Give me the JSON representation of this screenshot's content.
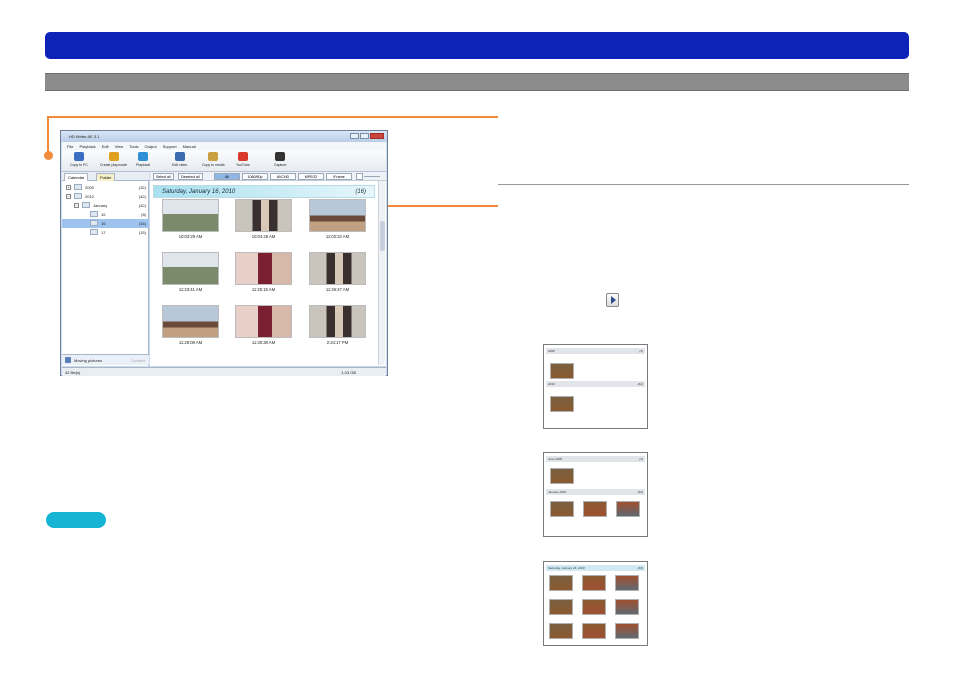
{
  "app": {
    "window_title": "HD Writer AE 3.1",
    "menu": [
      "File",
      "Playback",
      "Edit",
      "View",
      "Tools",
      "Output",
      "Support",
      "Manual"
    ],
    "toolbar": [
      "Copy to PC",
      "Create playmovie",
      "Playback",
      "Edit video",
      "Copy to media",
      "YouTube",
      "Capture"
    ],
    "tabs": {
      "calendar": "Calendar",
      "folder": "Folder"
    },
    "tree": [
      {
        "label": "2009",
        "count": "(32)",
        "level": 0,
        "expander": "+"
      },
      {
        "label": "2010",
        "count": "(42)",
        "level": 0,
        "expander": "−"
      },
      {
        "label": "January",
        "count": "(42)",
        "level": 1,
        "expander": "−"
      },
      {
        "label": "15",
        "count": "(8)",
        "level": 2,
        "expander": ""
      },
      {
        "label": "16",
        "count": "(16)",
        "level": 2,
        "expander": "",
        "selected": true
      },
      {
        "label": "17",
        "count": "(15)",
        "level": 2,
        "expander": ""
      }
    ],
    "controls": {
      "select_all": "Select all",
      "deselect_all": "Deselect all",
      "filters": [
        "All",
        "1080/60p",
        "AVCHD",
        "MPEG2",
        "iFrame"
      ]
    },
    "date_header": {
      "title": "Saturday, January 16, 2010",
      "count": "(16)"
    },
    "thumbnails": [
      {
        "time": "10:03:29 AM",
        "scene": "ferris"
      },
      {
        "time": "10:04:28 AM",
        "scene": "couple"
      },
      {
        "time": "11:02:22 AM",
        "scene": "coaster"
      },
      {
        "time": "11:23:41 AM",
        "scene": "ferris"
      },
      {
        "time": "11:25:15 AM",
        "scene": "girl"
      },
      {
        "time": "11:26:47 AM",
        "scene": "couple"
      },
      {
        "time": "11:28:08 AM",
        "scene": "coaster"
      },
      {
        "time": "11:30:38 AM",
        "scene": "girl"
      },
      {
        "time": "2:34:17 PM",
        "scene": "couple"
      }
    ],
    "mp_bar": "Moving pictures",
    "mp_bar_right": "Contact",
    "status_left": "42 file(s)",
    "status_right": "1.03 GB"
  },
  "previews": [
    {
      "sections": [
        {
          "title": "2009",
          "count": "(1)"
        },
        {
          "title": "2010",
          "count": "(42)"
        }
      ]
    },
    {
      "sections": [
        {
          "title": "June 2009",
          "count": "(1)"
        },
        {
          "title": "January 2010",
          "count": "(42)"
        }
      ]
    },
    {
      "sections": [
        {
          "title": "Saturday, January 16, 2010",
          "count": "(16)"
        }
      ]
    }
  ],
  "colors": {
    "header_bar": "#0d23b8",
    "sub_bar": "#8c8c8c",
    "callout": "#f28a3c",
    "note_pill": "#16b5d6"
  }
}
